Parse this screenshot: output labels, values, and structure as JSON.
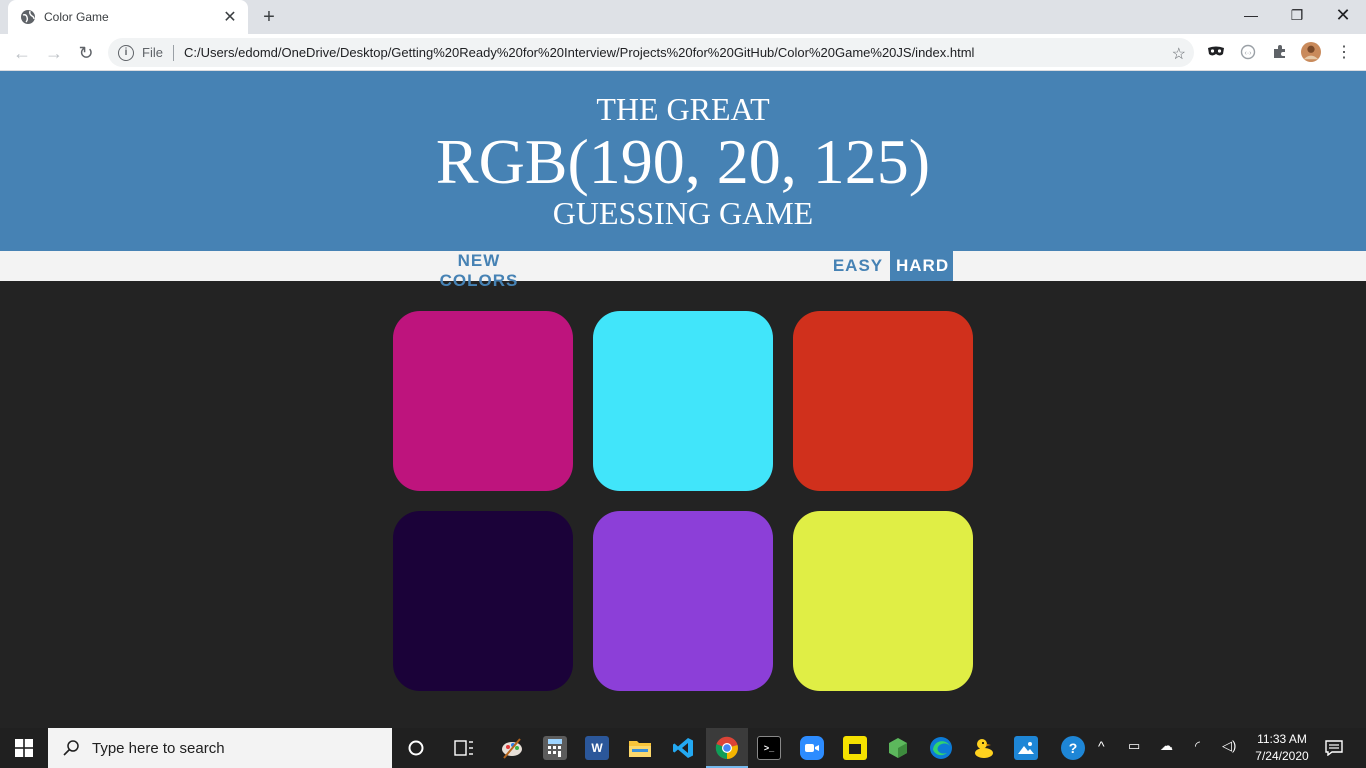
{
  "browser": {
    "tab_title": "Color Game",
    "file_label": "File",
    "url": "C:/Users/edomd/OneDrive/Desktop/Getting%20Ready%20for%20Interview/Projects%20for%20GitHub/Color%20Game%20JS/index.html"
  },
  "game": {
    "title_top": "The Great",
    "color_display": "RGB(190, 20, 125)",
    "title_bottom": "Guessing Game",
    "new_colors_label": "New Colors",
    "easy_label": "Easy",
    "hard_label": "Hard",
    "selected_mode": "hard",
    "squares": [
      {
        "color": "#be147d"
      },
      {
        "color": "#41e5fa"
      },
      {
        "color": "#d0301c"
      },
      {
        "color": "#1b0239"
      },
      {
        "color": "#8c3fd8"
      },
      {
        "color": "#e0ee45"
      }
    ]
  },
  "taskbar": {
    "search_placeholder": "Type here to search",
    "time": "11:33 AM",
    "date": "7/24/2020"
  }
}
